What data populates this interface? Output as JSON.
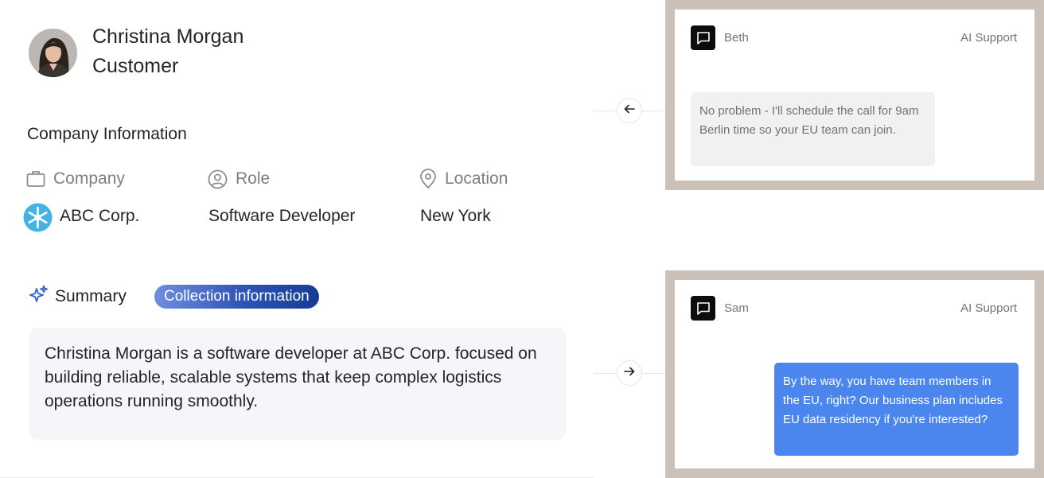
{
  "profile": {
    "name": "Christina Morgan",
    "type": "Customer"
  },
  "company_info": {
    "title": "Company Information",
    "fields": [
      {
        "label": "Company",
        "value": "ABC Corp.",
        "icon": "briefcase-icon"
      },
      {
        "label": "Role",
        "value": "Software Developer",
        "icon": "user-circle-icon"
      },
      {
        "label": "Location",
        "value": "New York",
        "icon": "map-pin-icon"
      }
    ]
  },
  "summary": {
    "title": "Summary",
    "badge": "Collection information",
    "text": "Christina Morgan is a software developer at ABC Corp. focused on building reliable, scalable systems that keep complex logistics operations running smoothly."
  },
  "chats": [
    {
      "agent": "Beth",
      "channel": "AI Support",
      "direction": "incoming",
      "message": "No problem - I'll schedule the call for 9am Berlin time so your EU team can join."
    },
    {
      "agent": "Sam",
      "channel": "AI Support",
      "direction": "outgoing",
      "message": "By the way, you have team members in the EU, right? Our business plan includes EU data residency if you're interested?"
    }
  ],
  "colors": {
    "accent_blue": "#4b86ee",
    "badge_start": "#6f8fe0",
    "badge_end": "#163b96",
    "card_frame": "#cbc1b8",
    "summary_bg": "#f4f6fa",
    "sparkle": "#2d5fd6"
  }
}
